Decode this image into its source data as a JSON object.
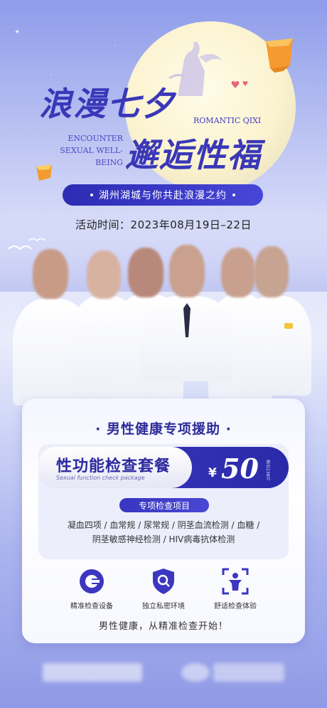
{
  "header": {
    "title_line1": "浪漫七夕",
    "title_line2": "邂逅性福",
    "english_right": "ROMANTIC QIXI",
    "english_left_line1": "ENCOUNTER",
    "english_left_line2": "SEXUAL WELL-BEING",
    "tagline": "湖州湖城与你共赴浪漫之约",
    "event_time": "活动时间：2023年08月19日–22日"
  },
  "card": {
    "title": "· 男性健康专项援助 ·",
    "package": {
      "name": "性功能检查套餐",
      "name_en": "Sexual function check package",
      "currency": "¥",
      "price": "50",
      "original_price": "原价238元"
    },
    "exam_label": "专项检查项目",
    "exam_items_line1": "凝血四项 / 血常规 / 尿常规 / 阴茎血流检测 / 血糖 /",
    "exam_items_line2": "阴茎敏感神经检测 / HIV病毒抗体检测",
    "features": [
      {
        "icon": "precision-device-icon",
        "label": "精准检查设备"
      },
      {
        "icon": "shield-search-icon",
        "label": "独立私密环境"
      },
      {
        "icon": "person-scan-icon",
        "label": "舒适检查体验"
      }
    ],
    "slogan": "男性健康，从精准检查开始！"
  },
  "colors": {
    "brand": "#3a37b8",
    "accent_dark": "#2a2aa8",
    "lantern": "#f5a43a"
  }
}
